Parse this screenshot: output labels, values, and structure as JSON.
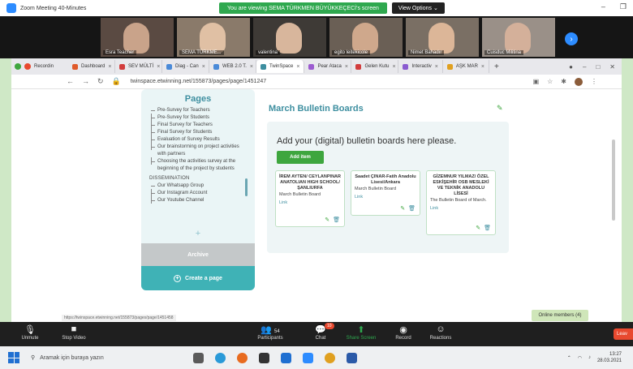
{
  "zoom": {
    "window_title": "Zoom Meeting 40-Minutes",
    "viewing_banner": "You are viewing SEMA TÜRKMEN BÜYÜKKEÇECİ's screen",
    "view_options": "View Options ⌄",
    "participants": [
      {
        "name": "Esra Teacher"
      },
      {
        "name": "SEMA TÜRKME..."
      },
      {
        "name": "valentina"
      },
      {
        "name": "egito leitekicole"
      },
      {
        "name": "Nimet Bahadır"
      },
      {
        "name": "Cuisduc Militina"
      }
    ],
    "toolbar": {
      "unmute": "Unmute",
      "stop_video": "Stop Video",
      "participants": "Participants",
      "participants_count": "54",
      "chat": "Chat",
      "chat_badge": "10",
      "share": "Share Screen",
      "record": "Record",
      "reactions": "Reactions",
      "leave": "Leav"
    }
  },
  "browser": {
    "extension_label": "Recordin",
    "tabs": [
      {
        "label": "Dashboard",
        "color": "#e05a2a",
        "active": false
      },
      {
        "label": "SEV MÜLTİ",
        "color": "#d23d3d",
        "active": false
      },
      {
        "label": "Diag - Can",
        "color": "#4a8ad8",
        "active": false
      },
      {
        "label": "WEB 2.0 T.",
        "color": "#4a8ad8",
        "active": false
      },
      {
        "label": "TwinSpace",
        "color": "#3e8fa0",
        "active": true
      },
      {
        "label": "Pear Ataca",
        "color": "#9c5bd0",
        "active": false
      },
      {
        "label": "Gelen Kutu",
        "color": "#d23d3d",
        "active": false
      },
      {
        "label": "Interactiv",
        "color": "#8a5bd0",
        "active": false
      },
      {
        "label": "AŞK MAR",
        "color": "#e0a020",
        "active": false
      }
    ],
    "url": "twinspace.etwinning.net/155873/pages/page/1451247",
    "status_url": "https://twinspace.etwinning.net/155873/pages/page/1451458"
  },
  "sidebar": {
    "title": "Pages",
    "items": [
      {
        "label": "Pre-Survey for Teachers"
      },
      {
        "label": "Pre-Survey for Students"
      },
      {
        "label": "Final Survey for Teachers"
      },
      {
        "label": "Final Survey for Students"
      },
      {
        "label": "Evaluation of Survey Results"
      },
      {
        "label": "Our brainstorming on project activities with partners"
      },
      {
        "label": "Choosing the activities survey at the beginning of the project by students"
      }
    ],
    "section": "DISSEMINATION",
    "section_items": [
      {
        "label": "Our Whatsapp Group"
      },
      {
        "label": "Our Instagram Account"
      },
      {
        "label": "Our Youtube Channel"
      }
    ],
    "add_symbol": "+",
    "archive": "Archive",
    "create_page": "Create a page"
  },
  "main": {
    "page_title": "March Bulletin Boards",
    "board_heading": "Add your (digital) bulletin boards here please.",
    "add_item": "Add item",
    "cards": [
      {
        "title": "İREM AYTEN/ CEYLANPINAR ANATOLIAN HIGH SCHOOL/ŞANLIURFA",
        "desc": "March Bulletin Board",
        "link": "Link"
      },
      {
        "title": "Saadet ÇINAR-Fatih Anadolu Lisesi/Ankara",
        "desc": "March Bulletin Board",
        "link": "Link"
      },
      {
        "title": "GİZEMNUR YILMAZ/ ÖZEL ESKİŞEHİR OSB MESLEKİ VE TEKNİK ANADOLU LİSESİ",
        "desc": "The Bulletin Board of March.",
        "link": "Link"
      }
    ],
    "online_members": "Online members (4)"
  },
  "taskbar": {
    "search_placeholder": "Aramak için buraya yazın",
    "time": "13:27",
    "date": "28.03.2021"
  }
}
